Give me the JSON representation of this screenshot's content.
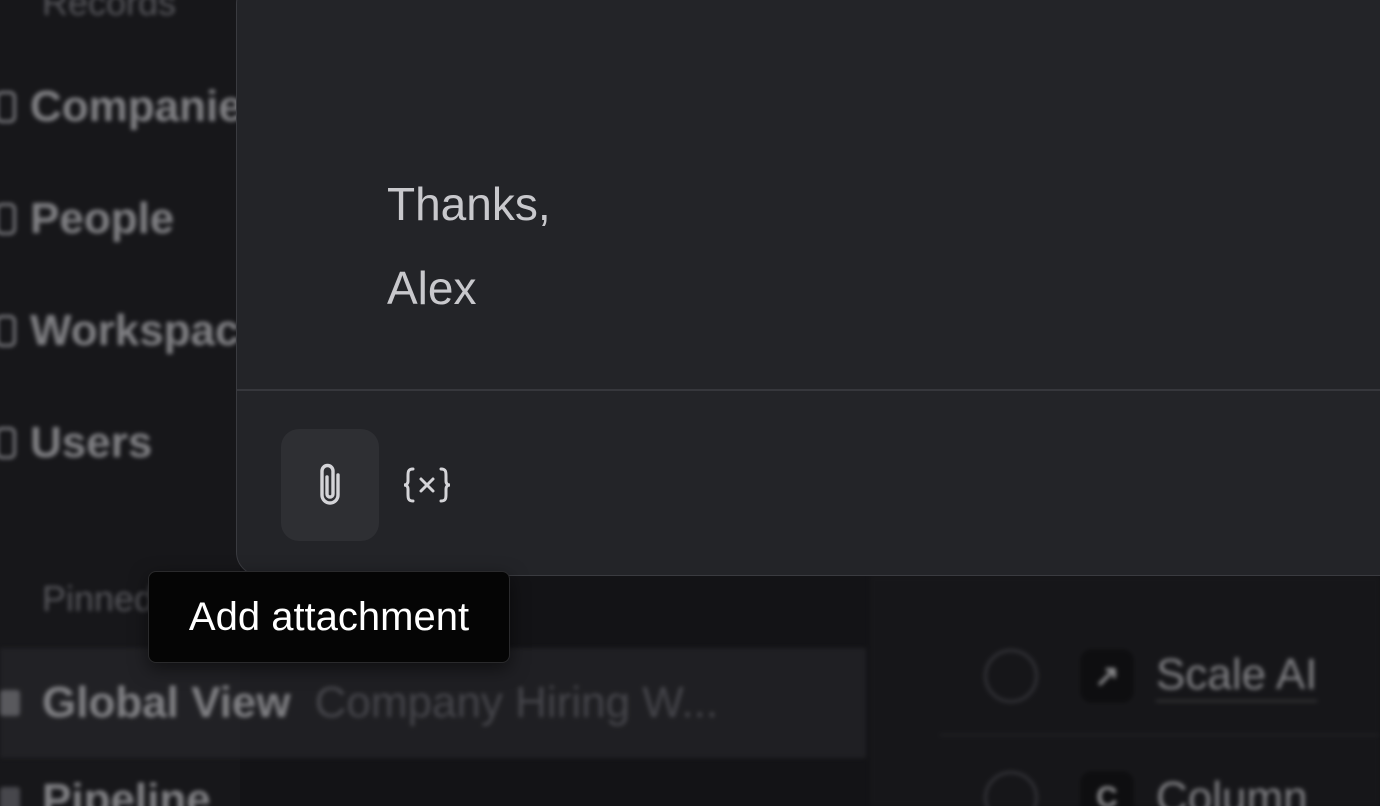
{
  "sidebar": {
    "items": [
      {
        "label": "Records"
      },
      {
        "label": "Companies"
      },
      {
        "label": "People"
      },
      {
        "label": "Workspaces"
      },
      {
        "label": "Users"
      }
    ],
    "pinned_label": "Pinned"
  },
  "list": {
    "rows": [
      {
        "title": "Global View",
        "subtitle": "Company Hiring W..."
      },
      {
        "title": "Pipeline",
        "subtitle": ""
      }
    ]
  },
  "records_panel": {
    "rows": [
      {
        "name": "Scale AI",
        "logo": "arrow-logo"
      },
      {
        "name": "Column",
        "logo": "c-logo"
      }
    ]
  },
  "composer": {
    "body_lines": [
      "Thanks,",
      "Alex"
    ],
    "attach_icon": "paperclip-icon",
    "variable_icon": "variable-braces-icon"
  },
  "tooltip": {
    "text": "Add attachment"
  },
  "colors": {
    "composer_bg": "#232428",
    "tooltip_bg": "#050505",
    "text_primary": "#c8c8cc"
  }
}
